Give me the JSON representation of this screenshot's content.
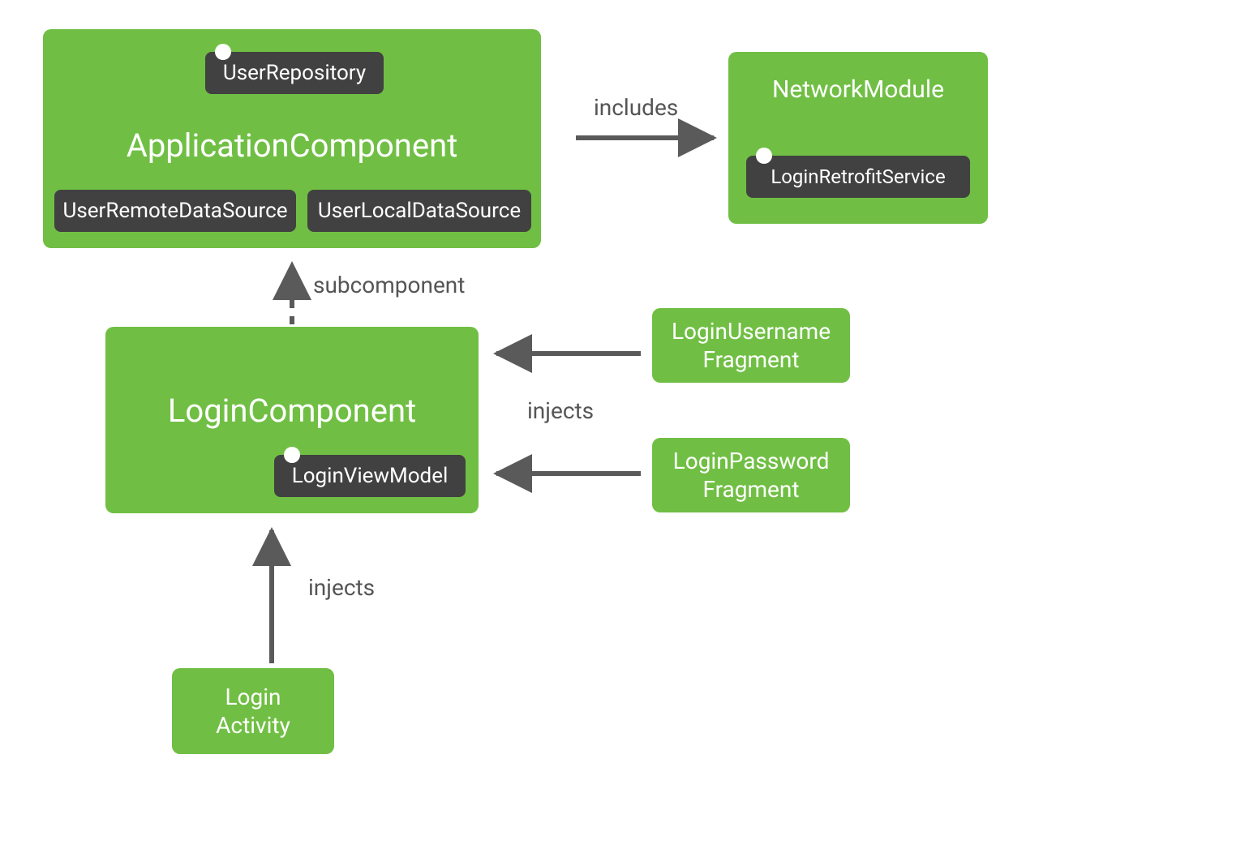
{
  "colors": {
    "node_fill": "#70bf44",
    "chip_fill": "#414141",
    "pin_fill": "#ffffff",
    "edge_stroke": "#5a5a5a",
    "label_color": "#555555",
    "text_on_green": "#ffffff",
    "text_on_dark": "#ffffff",
    "background": "#ffffff"
  },
  "nodes": {
    "application_component": {
      "title": "ApplicationComponent",
      "chips": {
        "user_repository": "UserRepository",
        "user_remote_ds": "UserRemoteDataSource",
        "user_local_ds": "UserLocalDataSource"
      }
    },
    "network_module": {
      "title": "NetworkModule",
      "chips": {
        "login_retrofit_service": "LoginRetrofitService"
      }
    },
    "login_component": {
      "title": "LoginComponent",
      "chips": {
        "login_view_model": "LoginViewModel"
      }
    },
    "login_username_fragment": {
      "line1": "LoginUsername",
      "line2": "Fragment"
    },
    "login_password_fragment": {
      "line1": "LoginPassword",
      "line2": "Fragment"
    },
    "login_activity": {
      "line1": "Login",
      "line2": "Activity"
    }
  },
  "edges": {
    "includes": {
      "label": "includes",
      "from": "application_component",
      "to": "network_module",
      "style": "solid"
    },
    "subcomponent": {
      "label": "subcomponent",
      "from": "login_component",
      "to": "application_component",
      "style": "dashed"
    },
    "injects_username": {
      "label": "injects",
      "from": "login_username_fragment",
      "to": "login_component",
      "style": "solid"
    },
    "injects_password": {
      "label": "injects",
      "from": "login_password_fragment",
      "to": "login_component",
      "style": "solid"
    },
    "injects_activity": {
      "label": "injects",
      "from": "login_activity",
      "to": "login_component",
      "style": "solid"
    }
  }
}
